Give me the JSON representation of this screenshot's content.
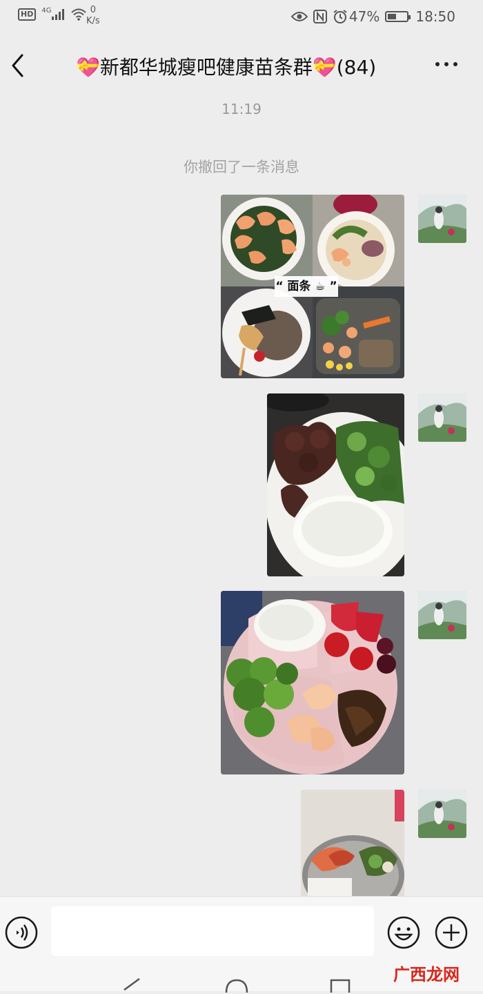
{
  "status_bar": {
    "hd": "HD",
    "network": "4G",
    "net_speed_value": "0",
    "net_speed_unit": "K/s",
    "battery_percent": "47%",
    "battery_level": 0.47,
    "time": "18:50"
  },
  "chat": {
    "title": "💝新都华城瘦吧健康苗条群💝(84)"
  },
  "messages": {
    "timestamp": "11:19",
    "recall_notice": "你撤回了一条消息"
  },
  "images": [
    {
      "overlay_text": "“ 面条 ☕ ”"
    },
    {},
    {},
    {}
  ],
  "input": {
    "value": "",
    "placeholder": ""
  },
  "watermark": {
    "text": "广西龙网"
  },
  "colors": {
    "background": "#ededed",
    "input_bar": "#f6f6f6",
    "system_text": "#a3a3a3",
    "watermark": "#d9261c"
  },
  "icons": [
    "hd-icon",
    "signal-icon",
    "wifi-icon",
    "eye-icon",
    "nfc-icon",
    "alarm-icon",
    "battery-icon",
    "back-icon",
    "more-icon",
    "voice-icon",
    "emoji-icon",
    "plus-icon",
    "nav-back-icon",
    "nav-home-icon",
    "nav-recent-icon"
  ]
}
